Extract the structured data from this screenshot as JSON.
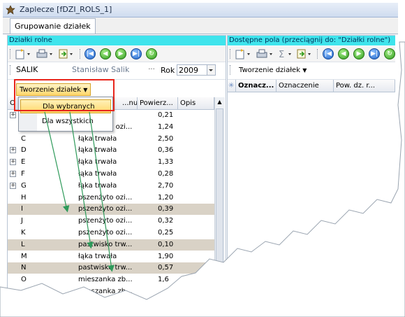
{
  "window": {
    "title": "Zaplecze [fDZI_ROLS_1]",
    "icon": "app-window-icon"
  },
  "tabs": [
    {
      "label": "Grupowanie działek"
    }
  ],
  "left_panel": {
    "header": "Działki rolne",
    "owner": {
      "code": "SALIK",
      "name": "Stanisław Salik",
      "ellipsis": "···",
      "year_label": "Rok",
      "year": "2009"
    },
    "create_button": "Tworzenie działek",
    "columns": [
      "O",
      "...nu ...",
      "Powierz...",
      "Opis"
    ],
    "rows": [
      {
        "id": "",
        "type": "",
        "area": "0,21",
        "expand": true
      },
      {
        "id": "",
        "type": "pszenżyto ozi...",
        "area": "1,24",
        "expand": false
      },
      {
        "id": "C",
        "type": "łąka trwała",
        "area": "2,50",
        "expand": false
      },
      {
        "id": "D",
        "type": "łąka trwała",
        "area": "0,36",
        "expand": true
      },
      {
        "id": "E",
        "type": "łąka trwała",
        "area": "1,33",
        "expand": true
      },
      {
        "id": "F",
        "type": "łąka trwała",
        "area": "0,28",
        "expand": true
      },
      {
        "id": "G",
        "type": "łąka trwała",
        "area": "2,70",
        "expand": true
      },
      {
        "id": "H",
        "type": "pszenżyto ozi...",
        "area": "1,20",
        "expand": false
      },
      {
        "id": "I",
        "type": "pszenżyto ozi...",
        "area": "0,39",
        "expand": false,
        "selected": true
      },
      {
        "id": "J",
        "type": "pszenżyto ozi...",
        "area": "0,32",
        "expand": false
      },
      {
        "id": "K",
        "type": "pszenżyto ozi...",
        "area": "0,25",
        "expand": false
      },
      {
        "id": "L",
        "type": "pastwisko trw...",
        "area": "0,10",
        "expand": false,
        "selected": true
      },
      {
        "id": "M",
        "type": "łąka trwała",
        "area": "1,90",
        "expand": false
      },
      {
        "id": "N",
        "type": "pastwisko trw...",
        "area": "0,57",
        "expand": false,
        "selected": true
      },
      {
        "id": "O",
        "type": "mieszanka zb...",
        "area": "1,6",
        "expand": false
      },
      {
        "id": "",
        "type": "mieszanka zb...",
        "area": "",
        "expand": false
      }
    ]
  },
  "menu": {
    "items": [
      {
        "label": "Dla wybranych"
      },
      {
        "label": "Dla wszystkich"
      }
    ]
  },
  "right_panel": {
    "header": "Dostępne pola (przeciągnij do: \"Działki rolne\")",
    "create_button": "Tworzenie działek",
    "columns": [
      "Oznacz...",
      "Oznaczenie",
      "Pow. dz. r..."
    ],
    "asterisk": "✳"
  },
  "colors": {
    "panel_header": "#3fe4ec",
    "selected_row": "#d9d2c6",
    "arrow": "#2e9a5a",
    "highlight_border": "#e8261c"
  }
}
